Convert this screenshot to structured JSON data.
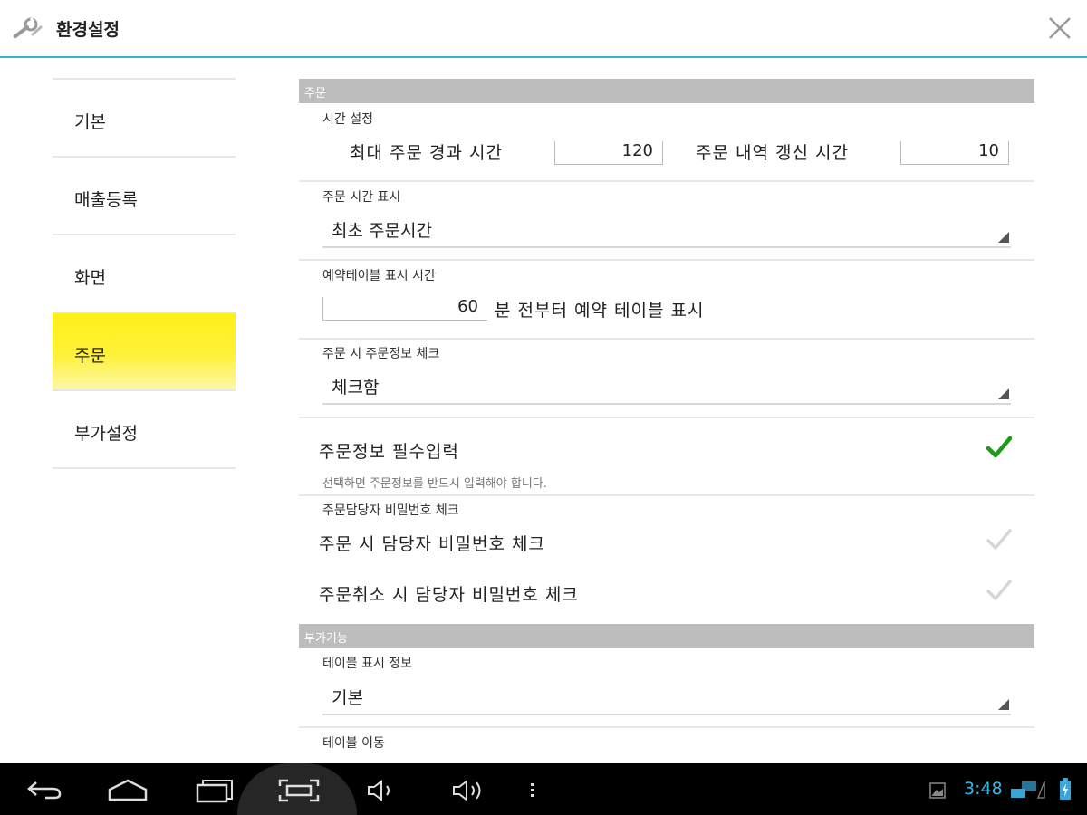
{
  "window": {
    "title": "환경설정"
  },
  "sidebar": {
    "items": [
      {
        "label": "기본"
      },
      {
        "label": "매출등록"
      },
      {
        "label": "화면"
      },
      {
        "label": "주문"
      },
      {
        "label": "부가설정"
      }
    ],
    "active_index": 3
  },
  "main": {
    "order_section": {
      "header": "주문",
      "time_setting": {
        "subtitle": "시간 설정",
        "max_elapsed_label": "최대 주문 경과 시간",
        "max_elapsed_value": "120",
        "refresh_label": "주문 내역 갱신 시간",
        "refresh_value": "10"
      },
      "time_display": {
        "subtitle": "주문 시간 표시",
        "selected": "최초 주문시간"
      },
      "reservation": {
        "subtitle": "예약테이블 표시 시간",
        "value": "60",
        "suffix": "분 전부터 예약 테이블 표시"
      },
      "info_check": {
        "subtitle": "주문 시 주문정보 체크",
        "selected": "체크함"
      },
      "required_input": {
        "label": "주문정보 필수입력",
        "hint": "선택하면 주문정보를 반드시 입력해야 합니다.",
        "checked": true
      },
      "password_check": {
        "subtitle": "주문담당자 비밀번호 체크",
        "on_order_label": "주문 시 담당자 비밀번호 체크",
        "on_order_checked": false,
        "on_cancel_label": "주문취소 시 담당자 비밀번호 체크",
        "on_cancel_checked": false
      }
    },
    "extra_section": {
      "header": "부가기능",
      "table_info": {
        "subtitle": "테이블 표시 정보",
        "selected": "기본"
      },
      "table_move_subtitle": "테이블 이동"
    }
  },
  "navbar": {
    "time": "3:48",
    "clock_color": "#37b6e6"
  },
  "colors": {
    "accent_line": "#35b6cf",
    "active_item": "#fff018",
    "section_header": "#bdbdbd",
    "check_on": "#1a9e1a",
    "check_off": "#d6d6d6"
  }
}
